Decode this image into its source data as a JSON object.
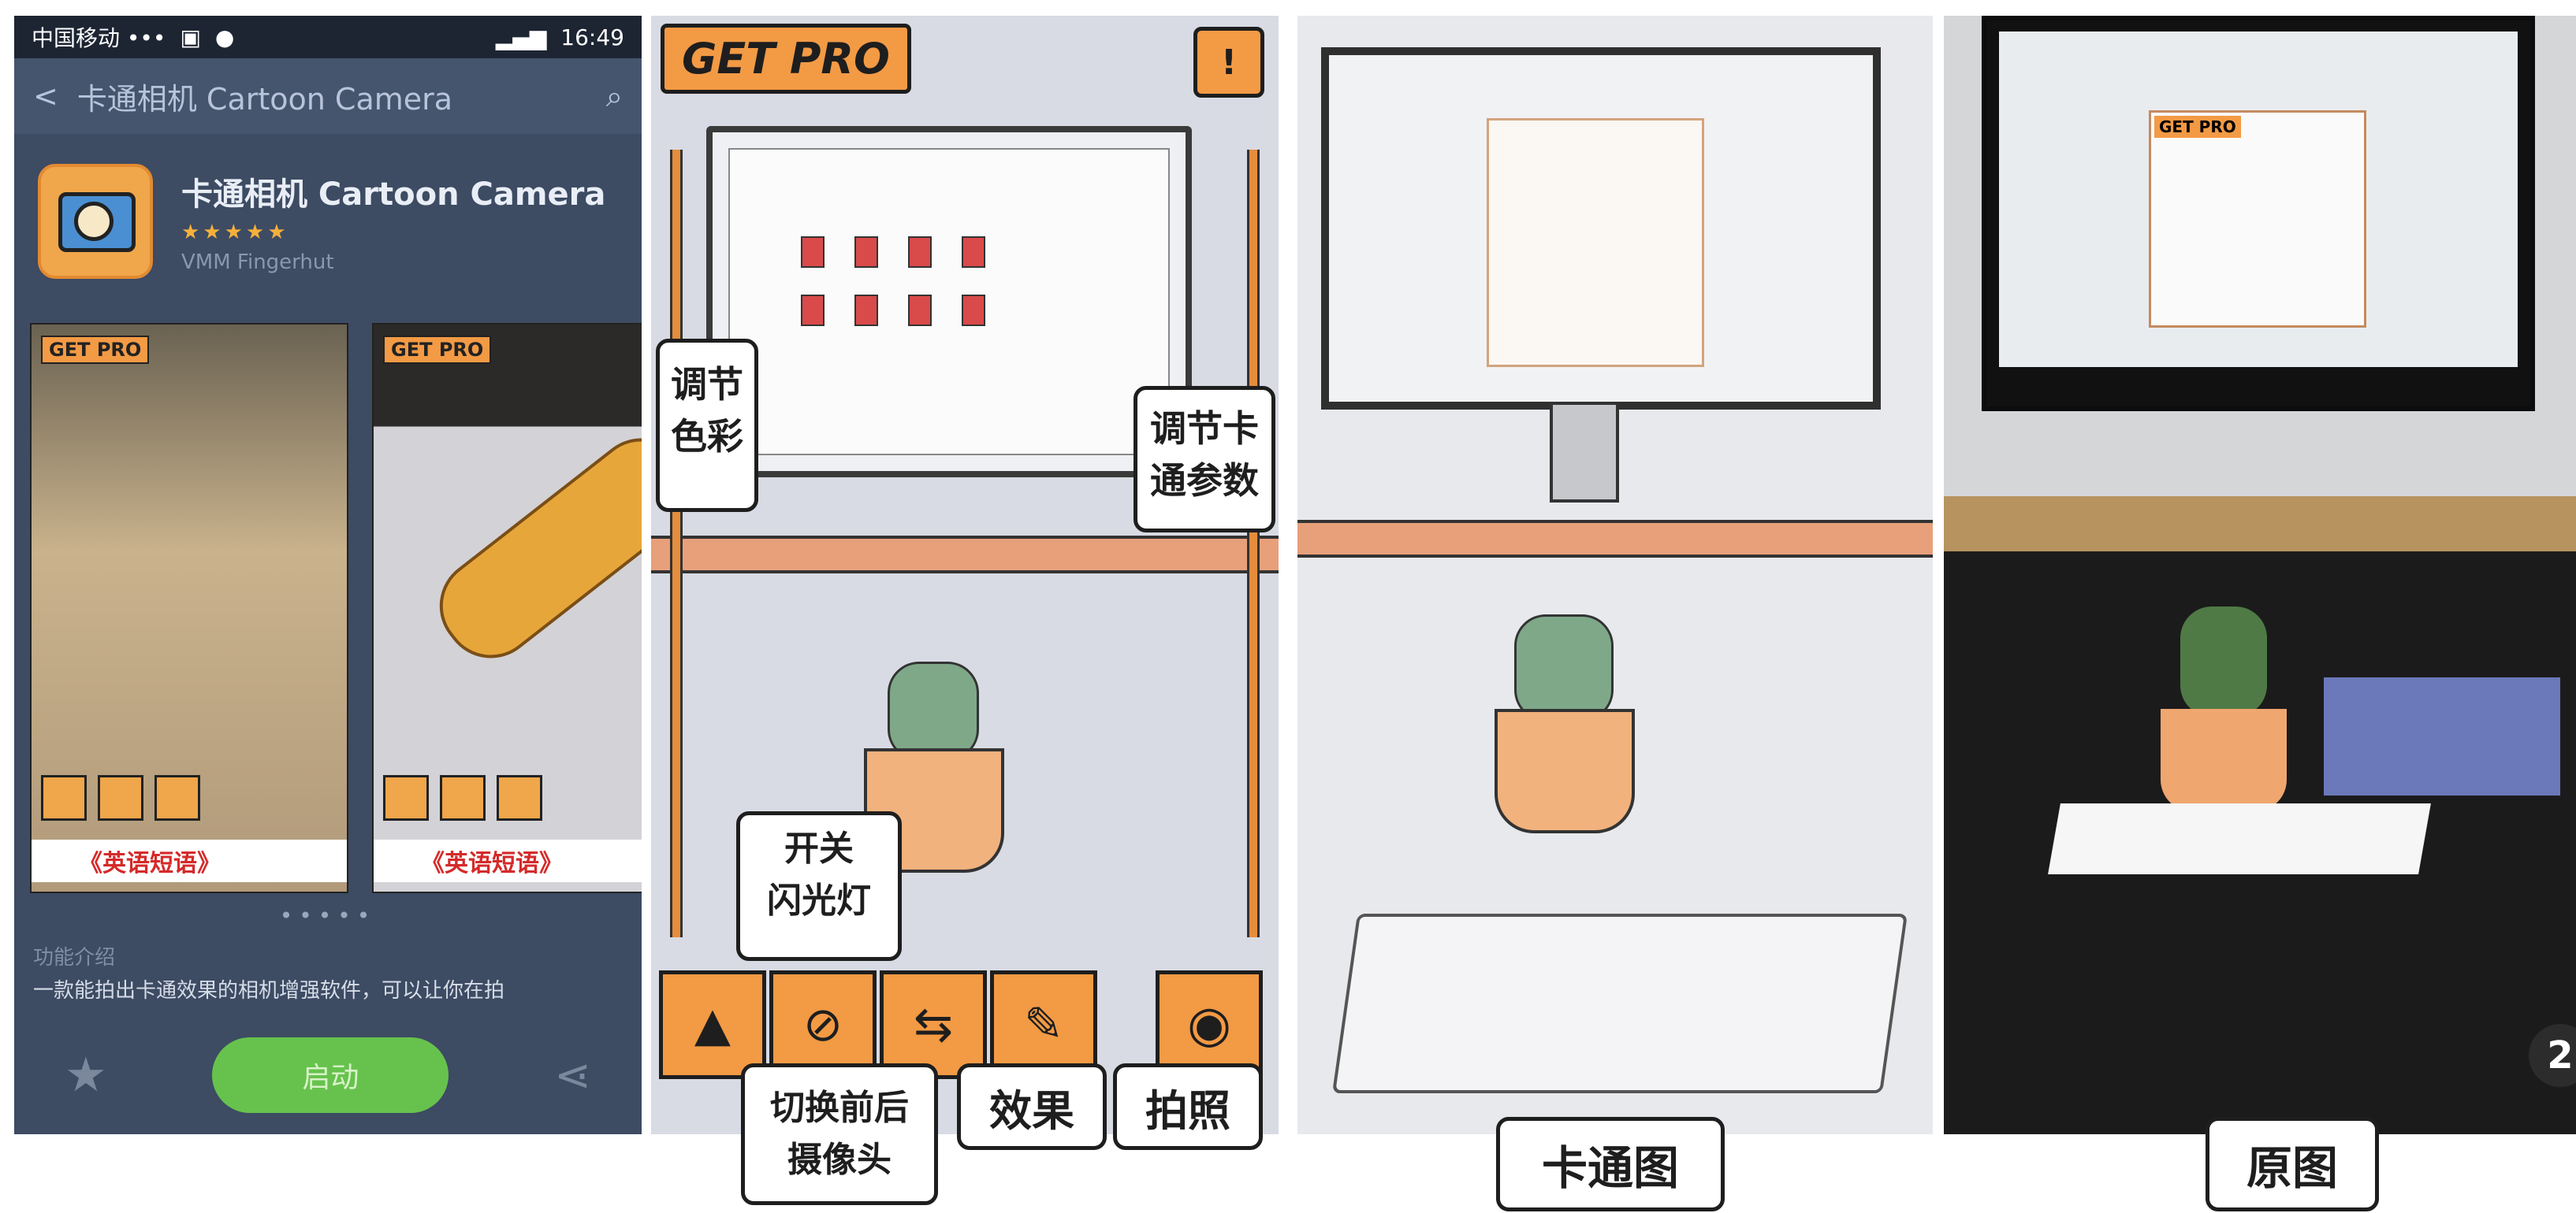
{
  "panel1": {
    "status": {
      "carrier": "中国移动 •••",
      "time": "16:49"
    },
    "nav": {
      "back": "<",
      "title": "卡通相机 Cartoon Camera",
      "search_icon": "search-icon"
    },
    "app": {
      "name": "卡通相机 Cartoon Camera",
      "stars": "★★★★★",
      "developer": "VMM Fingerhut"
    },
    "screenshots": [
      {
        "get_pro": "GET PRO",
        "ad": "《英语短语》"
      },
      {
        "get_pro": "GET PRO",
        "ad": "《英语短语》"
      }
    ],
    "dots": "•••••",
    "desc": {
      "heading": "功能介绍",
      "text": "一款能拍出卡通效果的相机增强软件，可以让你在拍"
    },
    "start_label": "启动"
  },
  "panel2": {
    "get_pro": "GET PRO",
    "info_glyph": "!",
    "callouts": {
      "adjust_color": "调节\n色彩",
      "adjust_cartoon": "调节卡\n通参数",
      "flash": "开关\n闪光灯",
      "switch_camera": "切换前后\n摄像头",
      "effect": "效果",
      "shoot": "拍照"
    }
  },
  "captions": {
    "cartoon": "卡通图",
    "original": "原图",
    "page_num": "2"
  },
  "colors": {
    "accent_orange": "#f39a45",
    "phone_bg": "#3d4b63",
    "start_green": "#67c24d"
  }
}
